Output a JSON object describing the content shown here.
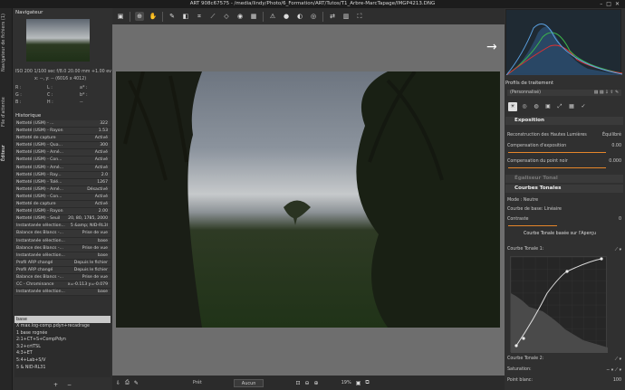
{
  "window": {
    "title": "ART 908c67575 - /media/lindy/Photo/6_Formation/ART/Tutos/T1_Arbre-MarcTapage/IMGP4213.DNG"
  },
  "sidetabs": [
    "Navigateur de fichiers (1)",
    "File d'attente",
    "Éditeur"
  ],
  "navigator": {
    "title": "Navigateur",
    "exif": "ISO 200   1/100 sec   f/8.0   20.00 mm   +1.00 ev",
    "coords": "x: --, y: --   (6016 x 4012)",
    "r_label": "R :",
    "g_label": "G :",
    "b_label": "B :",
    "l_label": "L :",
    "c_label": "C :",
    "h_label": "H :",
    "a_label": "a* :",
    "b2_label": "b* :",
    "dash": "--"
  },
  "history": {
    "title": "Historique",
    "rows": [
      [
        "Netteté (USM) - ...",
        "322"
      ],
      [
        "Netteté (USM) - Rayon",
        "1.53"
      ],
      [
        "Netteté de capture",
        "Activé"
      ],
      [
        "Netteté (USM) - Qua...",
        "300"
      ],
      [
        "Netteté (USM) - Amé...",
        "Activé"
      ],
      [
        "Netteté (USM) - Con...",
        "Activé"
      ],
      [
        "Netteté (USM) - Amé...",
        "Activé"
      ],
      [
        "Netteté (USM) - Ray...",
        "2.0"
      ],
      [
        "Netteté (USM) - Tolé...",
        "1267"
      ],
      [
        "Netteté (USM) - Amé...",
        "Désactivé"
      ],
      [
        "Netteté (USM) - Con...",
        "Activé"
      ],
      [
        "Netteté de capture",
        "Activé"
      ],
      [
        "Netteté (USM) - Rayon",
        "2.00"
      ],
      [
        "Netteté (USM) - Seuil",
        "20, 80, 1785, 2000"
      ],
      [
        "Instantanée sélection...",
        "5 &amp; NID-RL3l"
      ],
      [
        "Balance des Blancs -...",
        "Prise de vue"
      ],
      [
        "Instantanée sélection...",
        "base"
      ],
      [
        "Balance des Blancs -...",
        "Prise de vue"
      ],
      [
        "Instantanée sélection...",
        "base"
      ],
      [
        "Profil ARP changé",
        "Depuis le fichier"
      ],
      [
        "Profil ARP changé",
        "Depuis le fichier"
      ],
      [
        "Balance des Blancs -...",
        "Prise de vue"
      ],
      [
        "CC - Chrominance",
        "x=-0.113 y=-0.079"
      ],
      [
        "Instantanée sélection...",
        "base"
      ]
    ]
  },
  "snapshots": {
    "selected": "base",
    "items": [
      "X max.log-comp.pdyn+recadrage",
      "1 base rognée",
      "2:1+CT+S+CompPdyn",
      "3:2+crtTSL",
      "4:3+ET",
      "5:4+Lab+S/V",
      "5 & NID-RL31"
    ]
  },
  "toolbar": {
    "icons": [
      "clipboard-icon",
      "crosshair-icon",
      "hand-icon",
      "color-picker-icon",
      "wb-picker-icon",
      "crop-icon",
      "straighten-icon",
      "perspective-icon",
      "spot-icon",
      "mask-icon",
      "warning-icon",
      "highlight-icon",
      "shadow-icon",
      "focus-icon",
      "compare-icon",
      "grid-icon",
      "fullscreen-icon"
    ],
    "glyphs": [
      "▣",
      "⊕",
      "✋",
      "✎",
      "◧",
      "⌗",
      "⟋",
      "◇",
      "◉",
      "▦",
      "⚠",
      "●",
      "◐",
      "◎",
      "⇄",
      "▥",
      "⛶"
    ]
  },
  "statusbar": {
    "ready": "Prêt",
    "select": "Aucun",
    "zoom": "19%"
  },
  "rightpanel": {
    "profile_title": "Profils de traitement",
    "profile_value": "(Personnalisé)",
    "exposure": {
      "title": "Exposition",
      "reconstruction_label": "Reconstruction des Hautes Lumières",
      "reconstruction_value": "Équilibré",
      "comp_label": "Compensation d'exposition",
      "comp_value": "0.00",
      "black_label": "Compensation du point noir",
      "black_value": "0.000"
    },
    "tone_eq": {
      "title": "Égaliseur Tonal"
    },
    "tone_curves": {
      "title": "Courbes Tonales",
      "mode_label": "Mode :",
      "mode_value": "Neutre",
      "base_label": "Courbe de base:",
      "base_value": "Linéaire",
      "contrast_label": "Contraste",
      "contrast_value": "0",
      "tip": "Courbe Tonale basée sur l'Aperçu",
      "curve1_label": "Courbe Tonale 1:",
      "curve2_label": "Courbe Tonale 2:",
      "sat_label": "Saturation:",
      "white_label": "Point blanc:",
      "white_value": "100"
    }
  },
  "colors": {
    "accent": "#e6862a",
    "panel": "#303030",
    "canvas": "#6e6e6e"
  }
}
